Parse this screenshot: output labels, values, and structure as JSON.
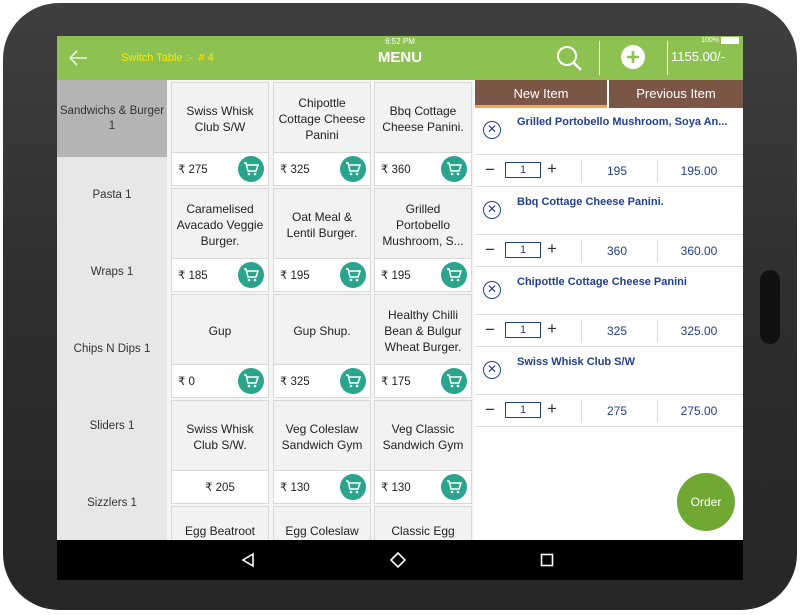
{
  "status": {
    "time": "6:52 PM",
    "battery": "100%"
  },
  "header": {
    "switch_table": "Switch Table :-",
    "table_number": "# 4",
    "title": "MENU",
    "total": "1155.00/-"
  },
  "categories": [
    {
      "label": "Sandwichs & Burger 1",
      "active": true
    },
    {
      "label": "Pasta 1"
    },
    {
      "label": "Wraps 1"
    },
    {
      "label": "Chips N Dips 1"
    },
    {
      "label": "Sliders 1"
    },
    {
      "label": "Sizzlers 1"
    }
  ],
  "menu_items": [
    {
      "name": "Swiss Whisk Club S/W",
      "price": "₹ 275",
      "cart": true
    },
    {
      "name": "Chipottle Cottage Cheese Panini",
      "price": "₹ 325",
      "cart": true
    },
    {
      "name": "Bbq Cottage Cheese Panini.",
      "price": "₹ 360",
      "cart": true
    },
    {
      "name": "Caramelised Avacado Veggie Burger.",
      "price": "₹ 185",
      "cart": true
    },
    {
      "name": "Oat Meal & Lentil Burger.",
      "price": "₹ 195",
      "cart": true
    },
    {
      "name": "Grilled Portobello Mushroom, S...",
      "price": "₹ 195",
      "cart": true
    },
    {
      "name": "Gup",
      "price": "₹ 0",
      "cart": true
    },
    {
      "name": "Gup Shup.",
      "price": "₹ 325",
      "cart": true
    },
    {
      "name": "Healthy Chilli Bean & Bulgur Wheat Burger.",
      "price": "₹ 175",
      "cart": true
    },
    {
      "name": "Swiss Whisk Club S/W.",
      "price": "₹ 205",
      "cart": false
    },
    {
      "name": "Veg Coleslaw Sandwich Gym",
      "price": "₹ 130",
      "cart": true
    },
    {
      "name": "Veg Classic Sandwich Gym",
      "price": "₹ 130",
      "cart": true
    },
    {
      "name": "Egg Beatroot Hummus",
      "price": "",
      "cart": false
    },
    {
      "name": "Egg Coleslaw",
      "price": "",
      "cart": false
    },
    {
      "name": "Classic Egg",
      "price": "",
      "cart": false
    }
  ],
  "order_tabs": {
    "new_item": "New Item",
    "previous_item": "Previous Item"
  },
  "order_items": [
    {
      "name": "Grilled Portobello Mushroom, Soya An...",
      "qty": "1",
      "unit_price": "195",
      "line_total": "195.00"
    },
    {
      "name": "Bbq Cottage Cheese Panini.",
      "qty": "1",
      "unit_price": "360",
      "line_total": "360.00"
    },
    {
      "name": "Chipottle Cottage Cheese Panini",
      "qty": "1",
      "unit_price": "325",
      "line_total": "325.00"
    },
    {
      "name": "Swiss Whisk Club S/W",
      "qty": "1",
      "unit_price": "275",
      "line_total": "275.00"
    }
  ],
  "order_button": "Order",
  "icons": {
    "back": "back-arrow-icon",
    "search": "search-icon",
    "add": "plus-icon",
    "cart": "cart-icon",
    "remove": "close-circle-icon"
  },
  "colors": {
    "header": "#8dc152",
    "tab": "#7b5546",
    "cart": "#2aa48c",
    "order_button": "#71a834",
    "text_blue": "#213f8d"
  }
}
